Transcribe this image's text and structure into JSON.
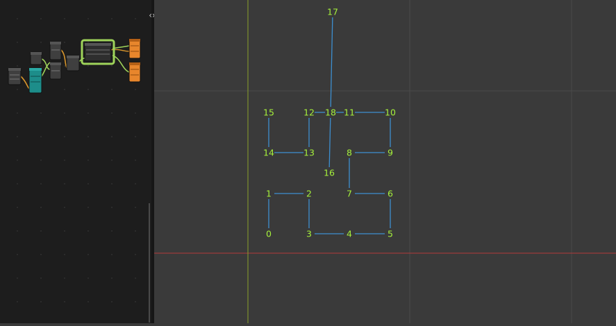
{
  "ui": {
    "sidebar_toggle_icon": "‹›"
  },
  "colors": {
    "node_editor_bg": "#1d1d1d",
    "viewport_bg": "#3a3a3a",
    "grid_line": "#4a4a4a",
    "axis_x": "#b33a3a",
    "axis_y": "#8aa32a",
    "vertex_index": "#a6f23b",
    "edge": "#3d8fd0",
    "node_frame_highlight": "#9fd45a",
    "node_output_orange": "#e8862c",
    "node_teal": "#1d8d8a"
  },
  "node_editor": {
    "nodes": [
      {
        "name": "node-a",
        "type": "geometry"
      },
      {
        "name": "node-b",
        "type": "teal"
      },
      {
        "name": "node-c",
        "type": "geometry"
      },
      {
        "name": "node-d",
        "type": "geometry"
      },
      {
        "name": "node-e",
        "type": "geometry"
      },
      {
        "name": "node-f",
        "type": "geometry"
      },
      {
        "name": "node-g-framed",
        "type": "selected-frame"
      },
      {
        "name": "node-output-1",
        "type": "orange"
      },
      {
        "name": "node-output-2",
        "type": "orange"
      }
    ]
  },
  "vertices": [
    {
      "index": "0"
    },
    {
      "index": "1"
    },
    {
      "index": "2"
    },
    {
      "index": "3"
    },
    {
      "index": "4"
    },
    {
      "index": "5"
    },
    {
      "index": "6"
    },
    {
      "index": "7"
    },
    {
      "index": "8"
    },
    {
      "index": "9"
    },
    {
      "index": "10"
    },
    {
      "index": "11"
    },
    {
      "index": "12"
    },
    {
      "index": "13"
    },
    {
      "index": "14"
    },
    {
      "index": "15"
    },
    {
      "index": "16"
    },
    {
      "index": "17"
    },
    {
      "index": "18"
    }
  ],
  "edges": [
    [
      "0",
      "1"
    ],
    [
      "1",
      "2"
    ],
    [
      "2",
      "3"
    ],
    [
      "3",
      "4"
    ],
    [
      "4",
      "5"
    ],
    [
      "5",
      "6"
    ],
    [
      "6",
      "7"
    ],
    [
      "7",
      "8"
    ],
    [
      "8",
      "9"
    ],
    [
      "9",
      "10"
    ],
    [
      "10",
      "11"
    ],
    [
      "11",
      "18"
    ],
    [
      "18",
      "12"
    ],
    [
      "12",
      "13"
    ],
    [
      "13",
      "14"
    ],
    [
      "14",
      "15"
    ],
    [
      "18",
      "17"
    ],
    [
      "18",
      "16"
    ]
  ]
}
